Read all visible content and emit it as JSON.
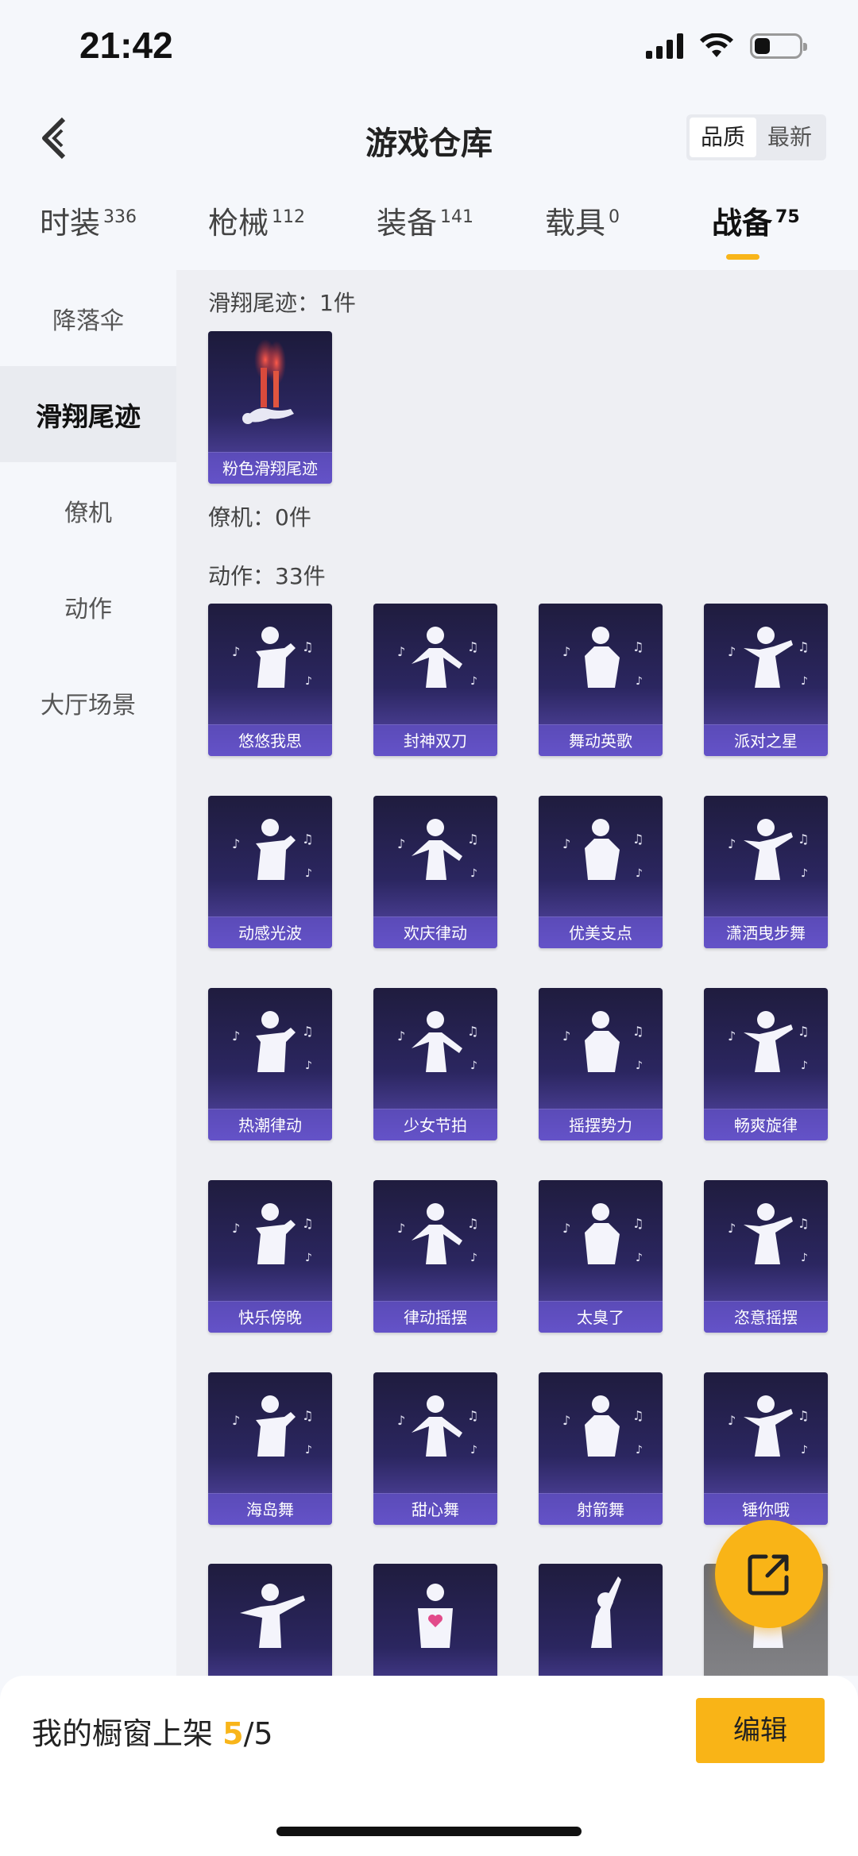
{
  "status_bar": {
    "time": "21:42",
    "battery_level": 0.35
  },
  "header": {
    "title": "游戏仓库",
    "sort_options": [
      "品质",
      "最新"
    ],
    "sort_active": "品质"
  },
  "category_tabs": [
    {
      "label": "时装",
      "count": "336"
    },
    {
      "label": "枪械",
      "count": "112"
    },
    {
      "label": "装备",
      "count": "141"
    },
    {
      "label": "载具",
      "count": "0"
    },
    {
      "label": "战备",
      "count": "75"
    }
  ],
  "active_category": "战备",
  "sidebar": {
    "items": [
      "降落伞",
      "滑翔尾迹",
      "僚机",
      "动作",
      "大厅场景"
    ],
    "active": "滑翔尾迹"
  },
  "sections": {
    "trail": {
      "label": "滑翔尾迹：1件",
      "items": [
        "粉色滑翔尾迹"
      ]
    },
    "wingman": {
      "label": "僚机：0件"
    },
    "emote": {
      "label": "动作：33件",
      "items": [
        "悠悠我思",
        "封神双刀",
        "舞动英歌",
        "派对之星",
        "动感光波",
        "欢庆律动",
        "优美支点",
        "潇洒曳步舞",
        "热潮律动",
        "少女节拍",
        "摇摆势力",
        "畅爽旋律",
        "快乐傍晚",
        "律动摇摆",
        "太臭了",
        "恣意摇摆",
        "海岛舞",
        "甜心舞",
        "射箭舞",
        "锤你哦"
      ]
    }
  },
  "bottom_bar": {
    "showcase_label": "我的橱窗上架",
    "showcase_count": "5",
    "showcase_total": "/5",
    "edit_label": "编辑"
  },
  "colors": {
    "accent": "#f9b417",
    "card_top": "#1f1c3e",
    "card_bottom": "#5a4bb0"
  },
  "icons": {
    "back": "chevron-left-icon",
    "fab": "share-external-icon"
  }
}
